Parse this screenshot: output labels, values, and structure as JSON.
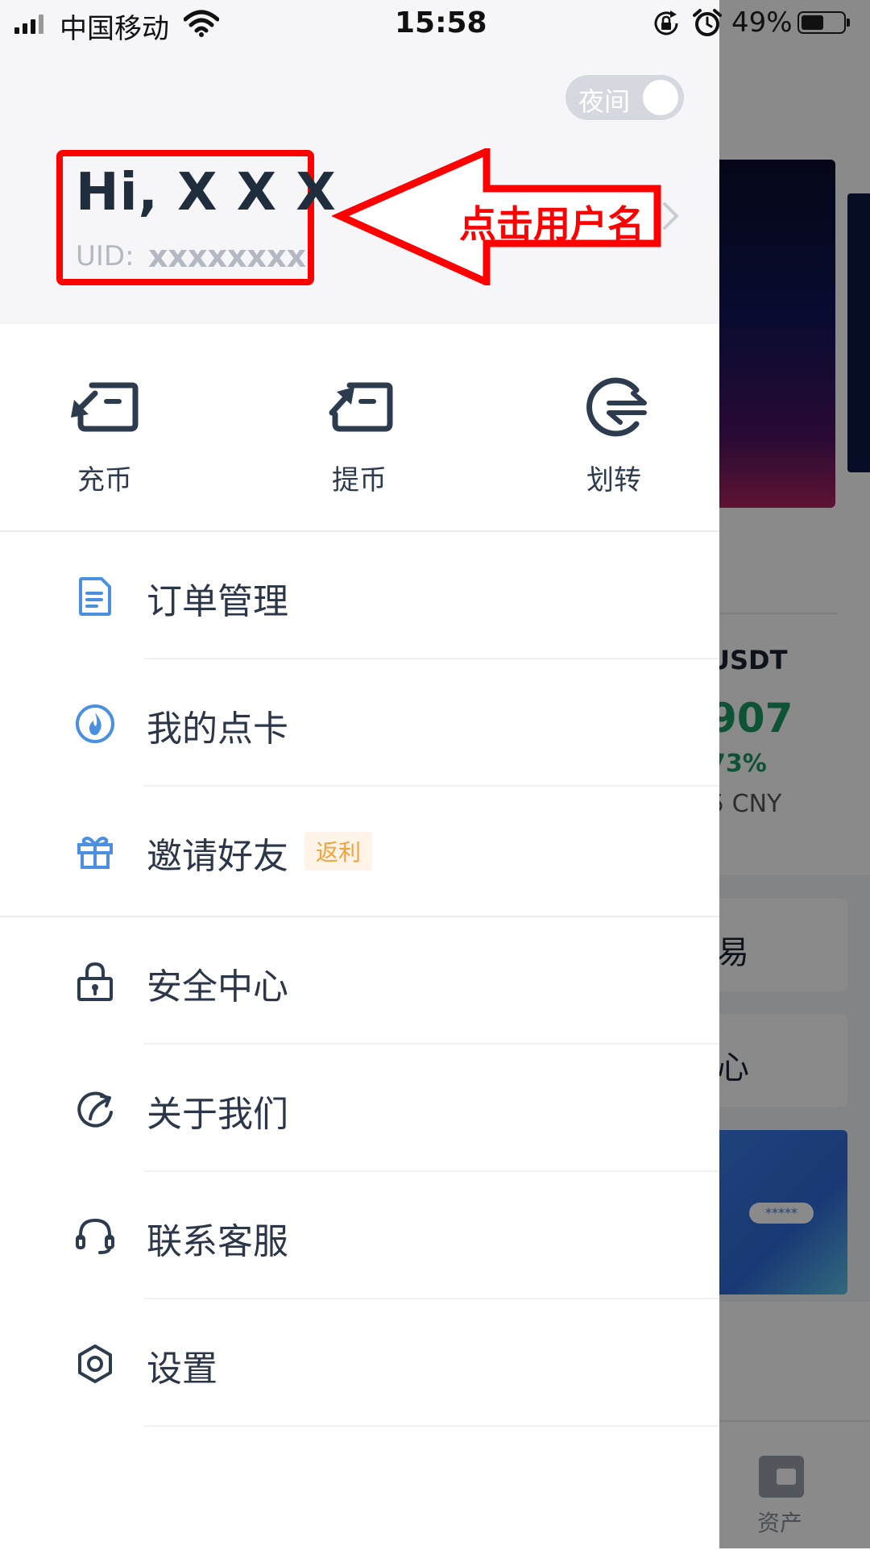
{
  "status_bar": {
    "carrier": "中国移动",
    "time": "15:58",
    "battery_percent": "49%",
    "battery_level": 0.49
  },
  "background": {
    "pair_label": "USDT",
    "price_partial": "907",
    "change_partial": "73%",
    "cny_partial": "5 CNY",
    "card1_partial": "易",
    "card2_partial": "心",
    "illustration_stars": "*****",
    "tab_assets_label": "资产"
  },
  "drawer": {
    "night_toggle": {
      "label": "夜间",
      "on": false
    },
    "user": {
      "greeting": "Hi, X X X",
      "uid_label": "UID:",
      "uid_value": "xxxxxxxx"
    },
    "annotation": {
      "text": "点击用户名",
      "color": "#ff0000"
    },
    "quick_actions": [
      {
        "label": "充币",
        "icon": "deposit-icon"
      },
      {
        "label": "提币",
        "icon": "withdraw-icon"
      },
      {
        "label": "划转",
        "icon": "transfer-icon"
      }
    ],
    "menu": [
      {
        "label": "订单管理",
        "icon": "order-document-icon"
      },
      {
        "label": "我的点卡",
        "icon": "point-card-flame-icon"
      },
      {
        "label": "邀请好友",
        "icon": "gift-icon",
        "badge": "返利"
      },
      {
        "label": "安全中心",
        "icon": "lock-icon"
      },
      {
        "label": "关于我们",
        "icon": "about-logo-icon"
      },
      {
        "label": "联系客服",
        "icon": "headset-icon"
      },
      {
        "label": "设置",
        "icon": "settings-hexagon-icon"
      }
    ]
  },
  "colors": {
    "accent_blue": "#4a8fe0",
    "text_dark": "#2b3648",
    "annotation_red": "#ff0000",
    "badge_orange": "#f5a23a",
    "price_green": "#1a9a62"
  }
}
